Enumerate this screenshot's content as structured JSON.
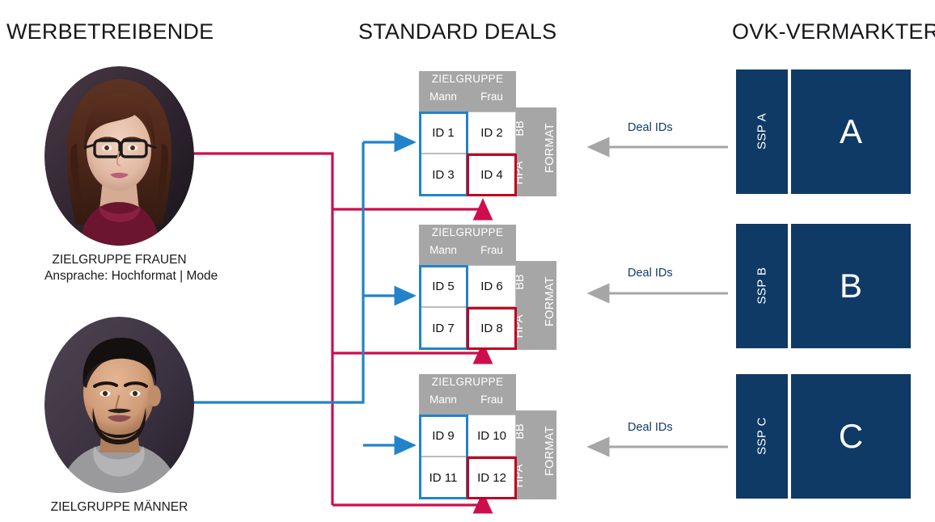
{
  "headings": {
    "left": "WERBETREIBENDE",
    "center": "STANDARD DEALS",
    "right": "OVK-VERMARKTER"
  },
  "colors": {
    "accent_blue": "#2283c8",
    "accent_red": "#c00020",
    "line_red": "#ce0e4c",
    "navy": "#103a66",
    "gray_header": "#a6a6a6",
    "arrow_gray": "#a6a6a6",
    "label_blue": "#123a6b"
  },
  "personas": [
    {
      "id": "frauen",
      "photo": "portrait-woman-glasses",
      "title": "ZIELGRUPPE FRAUEN",
      "subtitle": "Ansprache: Hochformat | Mode"
    },
    {
      "id": "maenner",
      "photo": "portrait-man-beard",
      "title": "ZIELGRUPPE MÄNNER",
      "subtitle": ""
    }
  ],
  "deal_tables": [
    {
      "id": "table-a",
      "group_header": "ZIELGRUPPE",
      "columns": [
        "Mann",
        "Frau"
      ],
      "format_label": "FORMAT",
      "format_rows": [
        "BB",
        "HPA"
      ],
      "cells": [
        [
          "ID 1",
          "ID 2"
        ],
        [
          "ID 3",
          "ID 4"
        ]
      ],
      "highlight_blue": "Mann column",
      "highlight_red": "ID 4"
    },
    {
      "id": "table-b",
      "group_header": "ZIELGRUPPE",
      "columns": [
        "Mann",
        "Frau"
      ],
      "format_label": "FORMAT",
      "format_rows": [
        "BB",
        "HPA"
      ],
      "cells": [
        [
          "ID 5",
          "ID 6"
        ],
        [
          "ID 7",
          "ID 8"
        ]
      ],
      "highlight_blue": "Mann column",
      "highlight_red": "ID 8"
    },
    {
      "id": "table-c",
      "group_header": "ZIELGRUPPE",
      "columns": [
        "Mann",
        "Frau"
      ],
      "format_label": "FORMAT",
      "format_rows": [
        "BB",
        "HPA"
      ],
      "cells": [
        [
          "ID 9",
          "ID 10"
        ],
        [
          "ID 11",
          "ID 12"
        ]
      ],
      "highlight_blue": "Mann column",
      "highlight_red": "ID 12"
    }
  ],
  "deal_id_flows": [
    {
      "id": "flow-a",
      "label": "Deal IDs",
      "direction": "right-to-left"
    },
    {
      "id": "flow-b",
      "label": "Deal IDs",
      "direction": "right-to-left"
    },
    {
      "id": "flow-c",
      "label": "Deal IDs",
      "direction": "right-to-left"
    }
  ],
  "ssps": [
    {
      "id": "ssp-a",
      "tag": "SSP A",
      "letter": "A"
    },
    {
      "id": "ssp-b",
      "tag": "SSP B",
      "letter": "B"
    },
    {
      "id": "ssp-c",
      "tag": "SSP C",
      "letter": "C"
    }
  ]
}
